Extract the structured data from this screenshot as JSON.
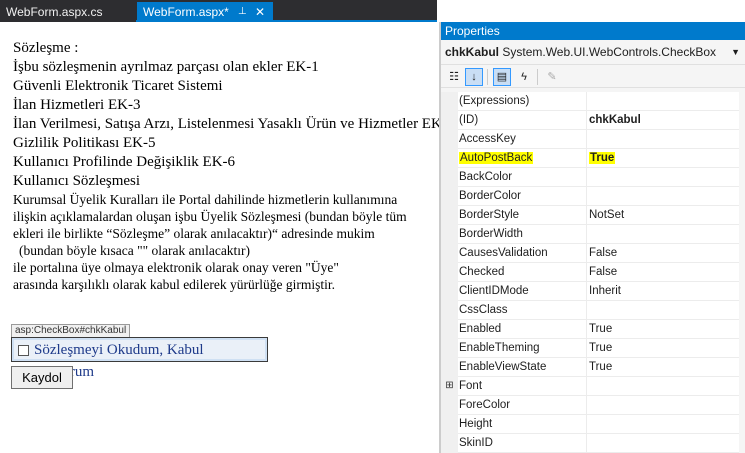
{
  "tabs": {
    "inactive": "WebForm.aspx.cs",
    "active": "WebForm.aspx*",
    "pin_icon": "pin-icon",
    "close_icon": "close-icon"
  },
  "designer": {
    "lines": [
      "Sözleşme :",
      "İşbu sözleşmenin ayrılmaz parçası olan ekler EK-1",
      "Güvenli Elektronik Ticaret Sistemi",
      "İlan Hizmetleri EK-3",
      "İlan Verilmesi, Satışa Arzı, Listelenmesi Yasaklı Ürün ve Hizmetler EK-",
      "Gizlilik Politikası EK-5",
      "Kullanıcı Profilinde Değişiklik EK-6",
      "Kullanıcı Sözleşmesi",
      "Kurumsal Üyelik Kuralları ile Portal dahilinde hizmetlerin kullanımına",
      "ilişkin açıklamalardan oluşan işbu Üyelik Sözleşmesi (bundan böyle tüm",
      "ekleri ile birlikte “Sözleşme” olarak anılacaktır)“ adresinde mukim",
      "(bundan böyle kısaca \"\" olarak anılacaktır)",
      "ile portalına üye olmaya elektronik olarak onay veren \"Üye\"",
      "arasında karşılıklı olarak kabul edilerek yürürlüğe girmiştir."
    ],
    "control_tag": "asp:CheckBox#chkKabul",
    "checkbox_label": "Sözleşmeyi Okudum, Kabul Ediyorum",
    "button_label": "Kaydol"
  },
  "properties": {
    "title": "Properties",
    "object_name": "chkKabul",
    "object_type": "System.Web.UI.WebControls.CheckBox",
    "rows": [
      {
        "name": "(Expressions)",
        "value": ""
      },
      {
        "name": "(ID)",
        "value": "chkKabul"
      },
      {
        "name": "AccessKey",
        "value": ""
      },
      {
        "name": "AutoPostBack",
        "value": "True"
      },
      {
        "name": "BackColor",
        "value": ""
      },
      {
        "name": "BorderColor",
        "value": ""
      },
      {
        "name": "BorderStyle",
        "value": "NotSet"
      },
      {
        "name": "BorderWidth",
        "value": ""
      },
      {
        "name": "CausesValidation",
        "value": "False"
      },
      {
        "name": "Checked",
        "value": "False"
      },
      {
        "name": "ClientIDMode",
        "value": "Inherit"
      },
      {
        "name": "CssClass",
        "value": ""
      },
      {
        "name": "Enabled",
        "value": "True"
      },
      {
        "name": "EnableTheming",
        "value": "True"
      },
      {
        "name": "EnableViewState",
        "value": "True"
      },
      {
        "name": "Font",
        "value": ""
      },
      {
        "name": "ForeColor",
        "value": ""
      },
      {
        "name": "Height",
        "value": ""
      },
      {
        "name": "SkinID",
        "value": ""
      }
    ]
  },
  "colors": {
    "accent": "#007acc",
    "highlight": "#ffff00"
  }
}
